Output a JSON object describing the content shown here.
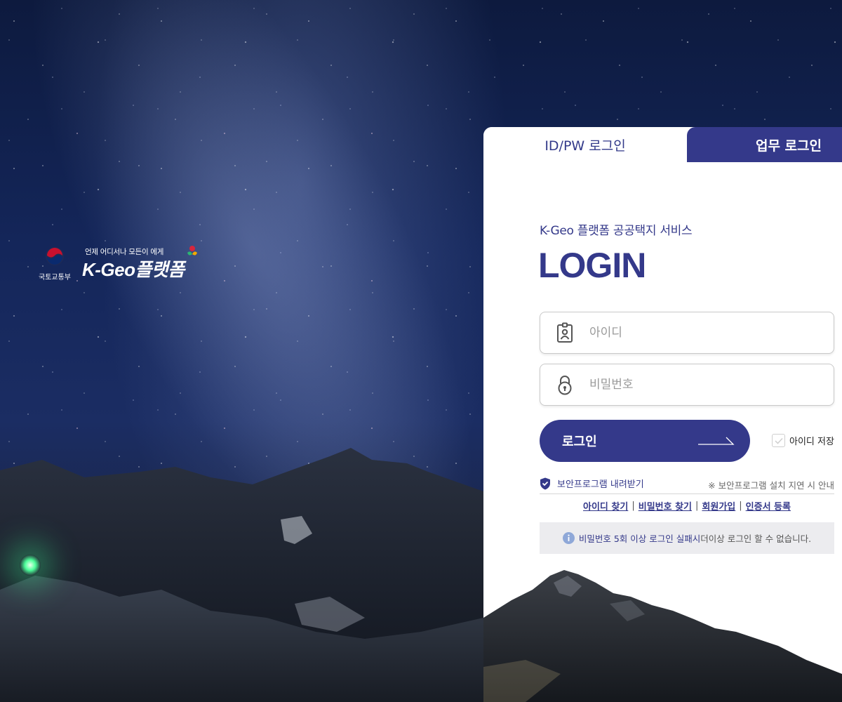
{
  "brand": {
    "ministry": "국토교통부",
    "tagline": "언제 어디서나 모든이 에게",
    "name": "K-Geo플랫폼"
  },
  "tabs": {
    "idpw": "ID/PW 로그인",
    "work": "업무 로그인"
  },
  "login": {
    "subtitle": "K-Geo 플랫폼 공공택지 서비스",
    "title": "LOGIN",
    "id_placeholder": "아이디",
    "pw_placeholder": "비밀번호",
    "button_label": "로그인",
    "save_id_label": "아이디 저장"
  },
  "security": {
    "download_label": "보안프로그램 내려받기",
    "note": "※ 보안프로그램 설치 지연 시 안내"
  },
  "links": {
    "find_id": "아이디 찾기",
    "find_pw": "비밀번호 찾기",
    "signup": "회원가입",
    "cert_register": "인증서 등록"
  },
  "notice": {
    "highlight": "비밀번호 5회 이상 로그인 실패시",
    "rest": "더이상 로그인 할 수 없습니다."
  },
  "colors": {
    "accent": "#34398a",
    "notice_bg": "#ececef"
  }
}
